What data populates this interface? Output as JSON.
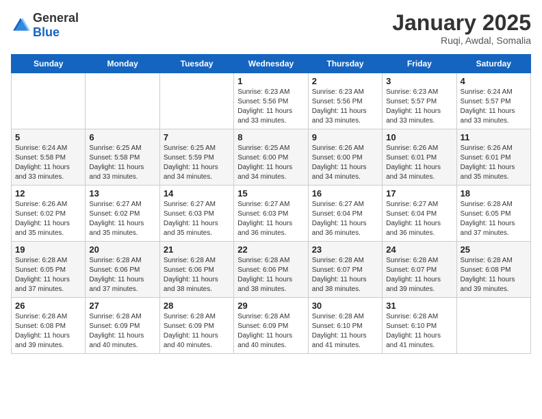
{
  "header": {
    "logo_general": "General",
    "logo_blue": "Blue",
    "title": "January 2025",
    "subtitle": "Ruqi, Awdal, Somalia"
  },
  "weekdays": [
    "Sunday",
    "Monday",
    "Tuesday",
    "Wednesday",
    "Thursday",
    "Friday",
    "Saturday"
  ],
  "weeks": [
    [
      {
        "day": "",
        "sunrise": "",
        "sunset": "",
        "daylight": ""
      },
      {
        "day": "",
        "sunrise": "",
        "sunset": "",
        "daylight": ""
      },
      {
        "day": "",
        "sunrise": "",
        "sunset": "",
        "daylight": ""
      },
      {
        "day": "1",
        "sunrise": "Sunrise: 6:23 AM",
        "sunset": "Sunset: 5:56 PM",
        "daylight": "Daylight: 11 hours and 33 minutes."
      },
      {
        "day": "2",
        "sunrise": "Sunrise: 6:23 AM",
        "sunset": "Sunset: 5:56 PM",
        "daylight": "Daylight: 11 hours and 33 minutes."
      },
      {
        "day": "3",
        "sunrise": "Sunrise: 6:23 AM",
        "sunset": "Sunset: 5:57 PM",
        "daylight": "Daylight: 11 hours and 33 minutes."
      },
      {
        "day": "4",
        "sunrise": "Sunrise: 6:24 AM",
        "sunset": "Sunset: 5:57 PM",
        "daylight": "Daylight: 11 hours and 33 minutes."
      }
    ],
    [
      {
        "day": "5",
        "sunrise": "Sunrise: 6:24 AM",
        "sunset": "Sunset: 5:58 PM",
        "daylight": "Daylight: 11 hours and 33 minutes."
      },
      {
        "day": "6",
        "sunrise": "Sunrise: 6:25 AM",
        "sunset": "Sunset: 5:58 PM",
        "daylight": "Daylight: 11 hours and 33 minutes."
      },
      {
        "day": "7",
        "sunrise": "Sunrise: 6:25 AM",
        "sunset": "Sunset: 5:59 PM",
        "daylight": "Daylight: 11 hours and 34 minutes."
      },
      {
        "day": "8",
        "sunrise": "Sunrise: 6:25 AM",
        "sunset": "Sunset: 6:00 PM",
        "daylight": "Daylight: 11 hours and 34 minutes."
      },
      {
        "day": "9",
        "sunrise": "Sunrise: 6:26 AM",
        "sunset": "Sunset: 6:00 PM",
        "daylight": "Daylight: 11 hours and 34 minutes."
      },
      {
        "day": "10",
        "sunrise": "Sunrise: 6:26 AM",
        "sunset": "Sunset: 6:01 PM",
        "daylight": "Daylight: 11 hours and 34 minutes."
      },
      {
        "day": "11",
        "sunrise": "Sunrise: 6:26 AM",
        "sunset": "Sunset: 6:01 PM",
        "daylight": "Daylight: 11 hours and 35 minutes."
      }
    ],
    [
      {
        "day": "12",
        "sunrise": "Sunrise: 6:26 AM",
        "sunset": "Sunset: 6:02 PM",
        "daylight": "Daylight: 11 hours and 35 minutes."
      },
      {
        "day": "13",
        "sunrise": "Sunrise: 6:27 AM",
        "sunset": "Sunset: 6:02 PM",
        "daylight": "Daylight: 11 hours and 35 minutes."
      },
      {
        "day": "14",
        "sunrise": "Sunrise: 6:27 AM",
        "sunset": "Sunset: 6:03 PM",
        "daylight": "Daylight: 11 hours and 35 minutes."
      },
      {
        "day": "15",
        "sunrise": "Sunrise: 6:27 AM",
        "sunset": "Sunset: 6:03 PM",
        "daylight": "Daylight: 11 hours and 36 minutes."
      },
      {
        "day": "16",
        "sunrise": "Sunrise: 6:27 AM",
        "sunset": "Sunset: 6:04 PM",
        "daylight": "Daylight: 11 hours and 36 minutes."
      },
      {
        "day": "17",
        "sunrise": "Sunrise: 6:27 AM",
        "sunset": "Sunset: 6:04 PM",
        "daylight": "Daylight: 11 hours and 36 minutes."
      },
      {
        "day": "18",
        "sunrise": "Sunrise: 6:28 AM",
        "sunset": "Sunset: 6:05 PM",
        "daylight": "Daylight: 11 hours and 37 minutes."
      }
    ],
    [
      {
        "day": "19",
        "sunrise": "Sunrise: 6:28 AM",
        "sunset": "Sunset: 6:05 PM",
        "daylight": "Daylight: 11 hours and 37 minutes."
      },
      {
        "day": "20",
        "sunrise": "Sunrise: 6:28 AM",
        "sunset": "Sunset: 6:06 PM",
        "daylight": "Daylight: 11 hours and 37 minutes."
      },
      {
        "day": "21",
        "sunrise": "Sunrise: 6:28 AM",
        "sunset": "Sunset: 6:06 PM",
        "daylight": "Daylight: 11 hours and 38 minutes."
      },
      {
        "day": "22",
        "sunrise": "Sunrise: 6:28 AM",
        "sunset": "Sunset: 6:06 PM",
        "daylight": "Daylight: 11 hours and 38 minutes."
      },
      {
        "day": "23",
        "sunrise": "Sunrise: 6:28 AM",
        "sunset": "Sunset: 6:07 PM",
        "daylight": "Daylight: 11 hours and 38 minutes."
      },
      {
        "day": "24",
        "sunrise": "Sunrise: 6:28 AM",
        "sunset": "Sunset: 6:07 PM",
        "daylight": "Daylight: 11 hours and 39 minutes."
      },
      {
        "day": "25",
        "sunrise": "Sunrise: 6:28 AM",
        "sunset": "Sunset: 6:08 PM",
        "daylight": "Daylight: 11 hours and 39 minutes."
      }
    ],
    [
      {
        "day": "26",
        "sunrise": "Sunrise: 6:28 AM",
        "sunset": "Sunset: 6:08 PM",
        "daylight": "Daylight: 11 hours and 39 minutes."
      },
      {
        "day": "27",
        "sunrise": "Sunrise: 6:28 AM",
        "sunset": "Sunset: 6:09 PM",
        "daylight": "Daylight: 11 hours and 40 minutes."
      },
      {
        "day": "28",
        "sunrise": "Sunrise: 6:28 AM",
        "sunset": "Sunset: 6:09 PM",
        "daylight": "Daylight: 11 hours and 40 minutes."
      },
      {
        "day": "29",
        "sunrise": "Sunrise: 6:28 AM",
        "sunset": "Sunset: 6:09 PM",
        "daylight": "Daylight: 11 hours and 40 minutes."
      },
      {
        "day": "30",
        "sunrise": "Sunrise: 6:28 AM",
        "sunset": "Sunset: 6:10 PM",
        "daylight": "Daylight: 11 hours and 41 minutes."
      },
      {
        "day": "31",
        "sunrise": "Sunrise: 6:28 AM",
        "sunset": "Sunset: 6:10 PM",
        "daylight": "Daylight: 11 hours and 41 minutes."
      },
      {
        "day": "",
        "sunrise": "",
        "sunset": "",
        "daylight": ""
      }
    ]
  ]
}
